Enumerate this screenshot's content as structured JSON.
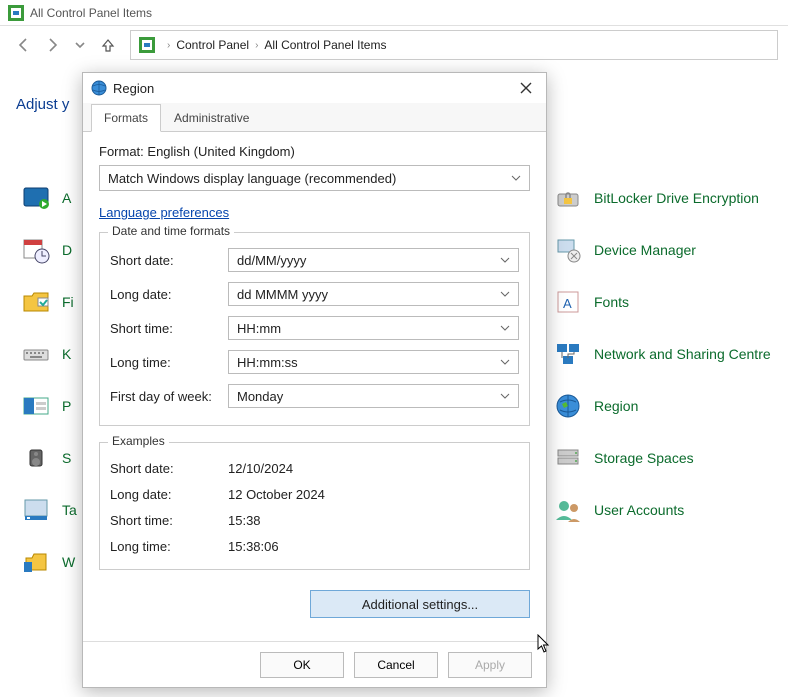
{
  "window_title": "All Control Panel Items",
  "breadcrumb": {
    "a": "Control Panel",
    "b": "All Control Panel Items"
  },
  "adjust_label": "Adjust y",
  "left_items": [
    {
      "label": "A"
    },
    {
      "label": "D"
    },
    {
      "label": "Fi"
    },
    {
      "label": "K"
    },
    {
      "label": "P"
    },
    {
      "label": "S"
    },
    {
      "label": "Ta"
    },
    {
      "label": "W"
    }
  ],
  "right_items": [
    {
      "label": "BitLocker Drive Encryption"
    },
    {
      "label": "Device Manager"
    },
    {
      "label": "Fonts"
    },
    {
      "label": "Network and Sharing Centre"
    },
    {
      "label": "Region"
    },
    {
      "label": "Storage Spaces"
    },
    {
      "label": "User Accounts"
    }
  ],
  "dialog": {
    "title": "Region",
    "tabs": {
      "formats": "Formats",
      "admin": "Administrative"
    },
    "format_label": "Format: English (United Kingdom)",
    "lang_select": "Match Windows display language (recommended)",
    "lang_pref_link": "Language preferences",
    "dt_group": "Date and time formats",
    "rows": {
      "short_date": {
        "lbl": "Short date:",
        "val": "dd/MM/yyyy"
      },
      "long_date": {
        "lbl": "Long date:",
        "val": "dd MMMM yyyy"
      },
      "short_time": {
        "lbl": "Short time:",
        "val": "HH:mm"
      },
      "long_time": {
        "lbl": "Long time:",
        "val": "HH:mm:ss"
      },
      "first_day": {
        "lbl": "First day of week:",
        "val": "Monday"
      }
    },
    "examples_group": "Examples",
    "ex": {
      "short_date": {
        "lbl": "Short date:",
        "val": "12/10/2024"
      },
      "long_date": {
        "lbl": "Long date:",
        "val": "12 October 2024"
      },
      "short_time": {
        "lbl": "Short time:",
        "val": "15:38"
      },
      "long_time": {
        "lbl": "Long time:",
        "val": "15:38:06"
      }
    },
    "additional": "Additional settings...",
    "ok": "OK",
    "cancel": "Cancel",
    "apply": "Apply"
  }
}
